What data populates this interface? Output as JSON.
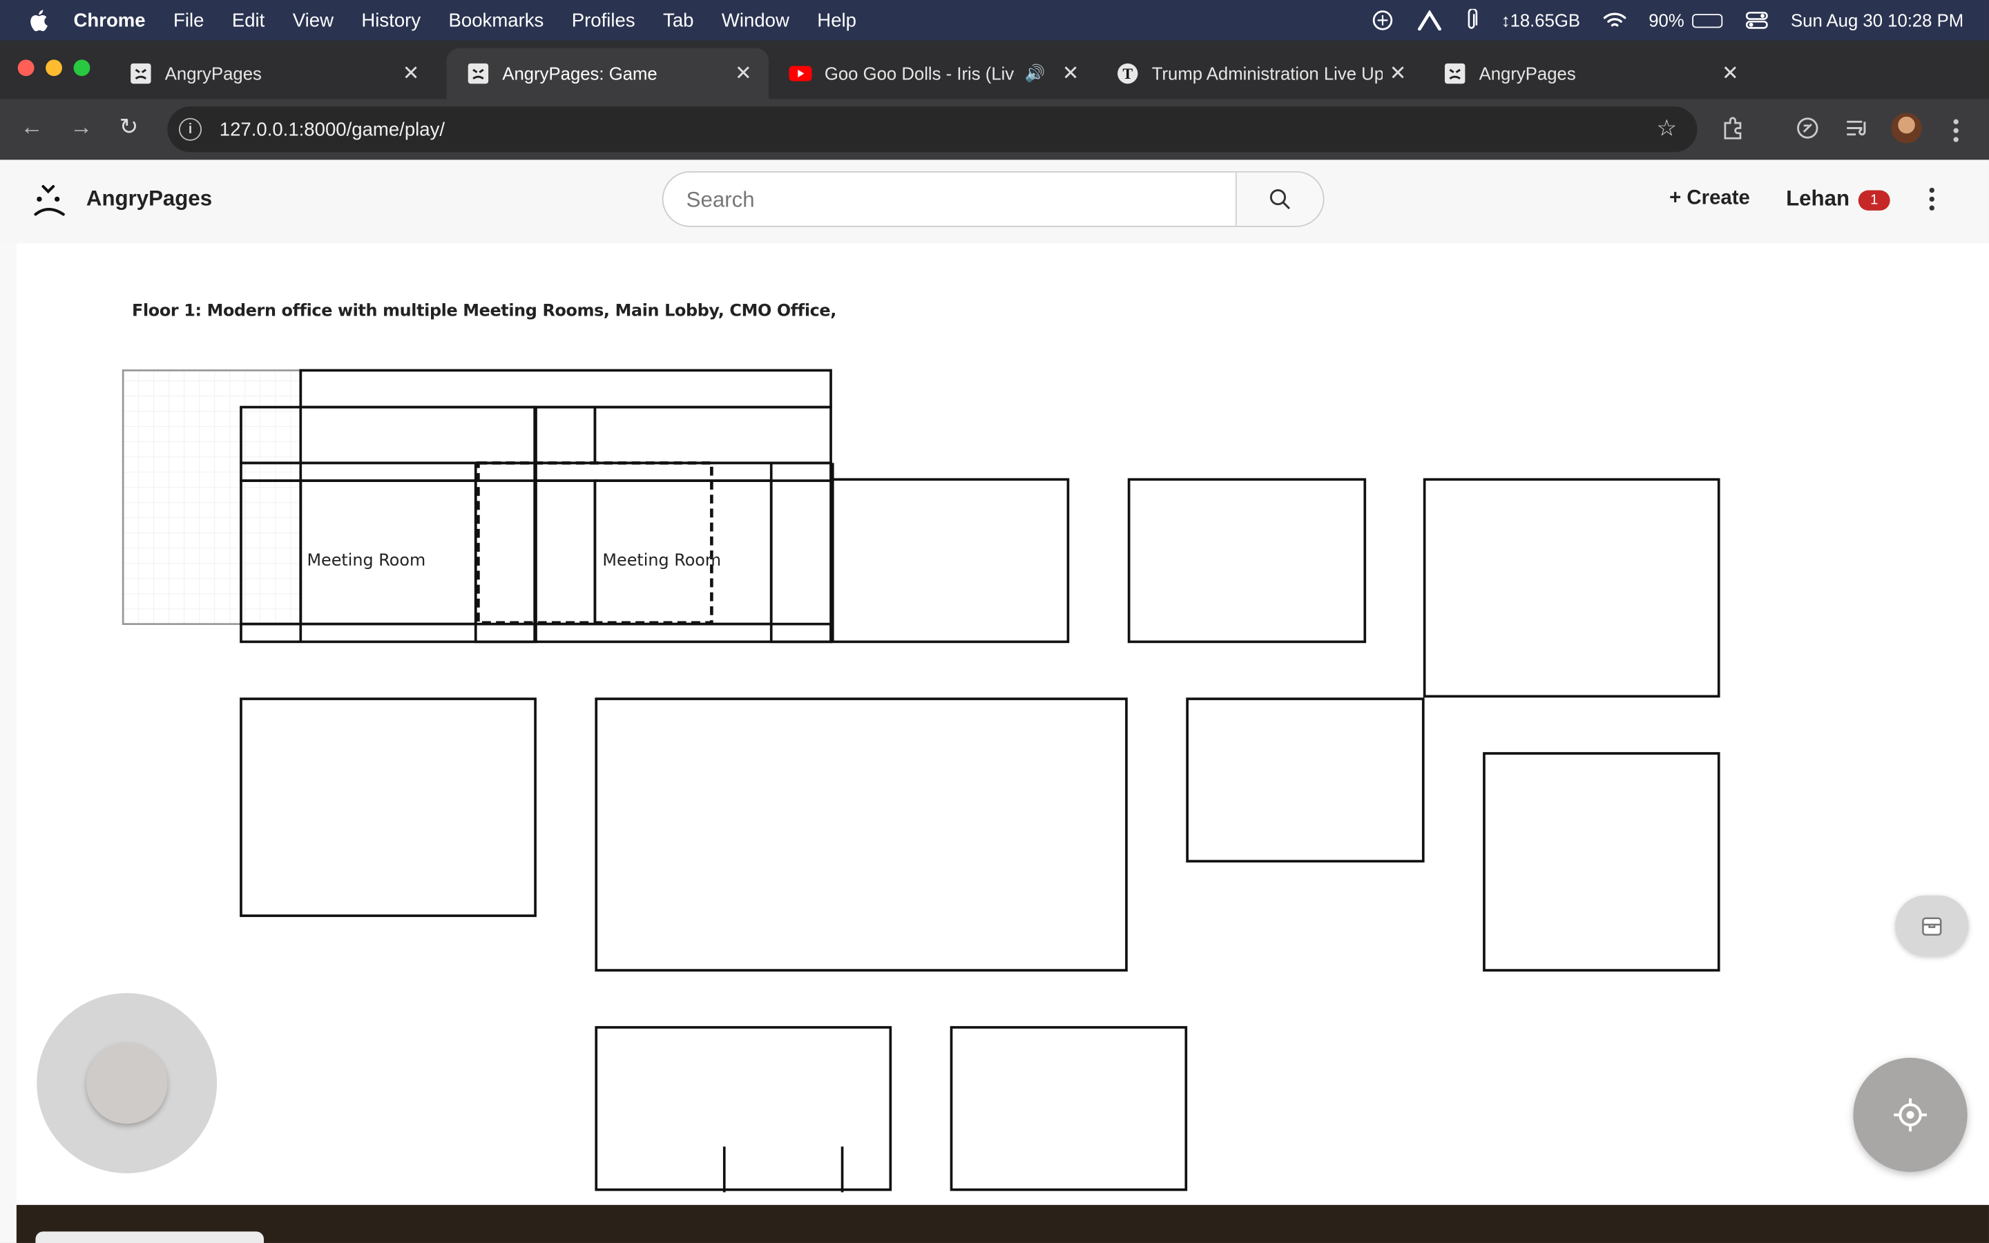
{
  "menubar": {
    "app": "Chrome",
    "items": [
      "File",
      "Edit",
      "View",
      "History",
      "Bookmarks",
      "Profiles",
      "Tab",
      "Window",
      "Help"
    ],
    "memory": "↕18.65GB",
    "battery_pct": "90%",
    "battery_level": 0.9,
    "datetime": "Sun Aug 30  10:28 PM"
  },
  "tabs": [
    {
      "title": "AngryPages",
      "active": false
    },
    {
      "title": "AngryPages: Game",
      "active": true
    },
    {
      "title": "Goo Goo Dolls - Iris (Live",
      "active": false
    },
    {
      "title": "Trump Administration Live Up",
      "active": false
    },
    {
      "title": "AngryPages",
      "active": false
    }
  ],
  "omnibox": {
    "url": "127.0.0.1:8000/game/play/"
  },
  "header": {
    "brand": "AngryPages",
    "search_placeholder": "Search",
    "create_label": "+ Create",
    "user_name": "Lehan",
    "notification_count": "1"
  },
  "game": {
    "floor_title": "Floor 1: Modern office with multiple Meeting Rooms, Main Lobby, CMO Office,",
    "room_labels": [
      "Meeting Room",
      "Meeting Room"
    ]
  },
  "colors": {
    "menubar_bg": "#2a3350",
    "tabstrip_bg": "#2e2e30",
    "toolbar_bg": "#3c3c3e",
    "badge_red": "#c62828",
    "youtube_red": "#ff0000"
  }
}
